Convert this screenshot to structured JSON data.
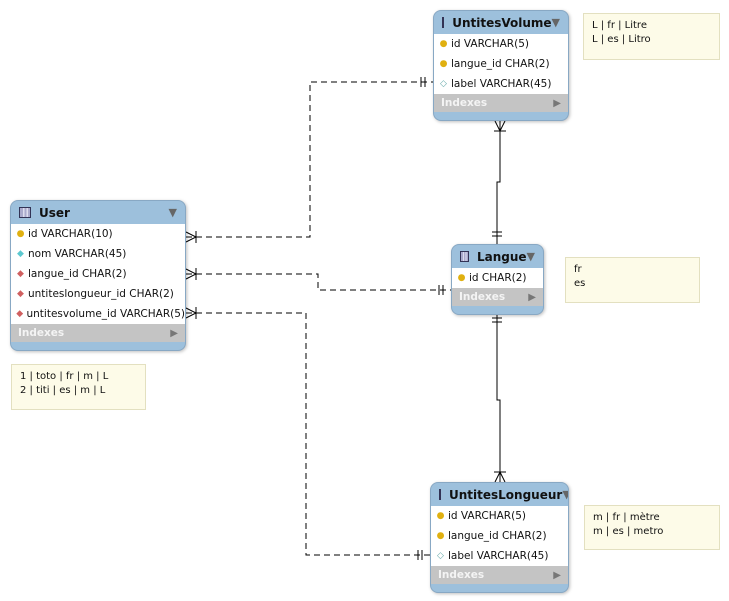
{
  "tables": {
    "volume": {
      "name": "UntitesVolume",
      "columns": [
        {
          "icon": "key",
          "text": "id VARCHAR(5)"
        },
        {
          "icon": "key",
          "text": "langue_id CHAR(2)"
        },
        {
          "icon": "empty-diamond",
          "text": "label VARCHAR(45)"
        }
      ],
      "indexes": "Indexes"
    },
    "user": {
      "name": "User",
      "columns": [
        {
          "icon": "key",
          "text": "id VARCHAR(10)"
        },
        {
          "icon": "diamond",
          "text": "nom VARCHAR(45)"
        },
        {
          "icon": "fk-diamond",
          "text": "langue_id CHAR(2)"
        },
        {
          "icon": "fk-diamond",
          "text": "untiteslongueur_id CHAR(2)"
        },
        {
          "icon": "fk-diamond",
          "text": "untitesvolume_id VARCHAR(5)"
        }
      ],
      "indexes": "Indexes"
    },
    "langue": {
      "name": "Langue",
      "columns": [
        {
          "icon": "key",
          "text": "id CHAR(2)"
        }
      ],
      "indexes": "Indexes"
    },
    "longueur": {
      "name": "UntitesLongueur",
      "columns": [
        {
          "icon": "key",
          "text": "id VARCHAR(5)"
        },
        {
          "icon": "key",
          "text": "langue_id CHAR(2)"
        },
        {
          "icon": "empty-diamond",
          "text": "label VARCHAR(45)"
        }
      ],
      "indexes": "Indexes"
    }
  },
  "notes": {
    "volume": [
      "L | fr | Litre",
      "L | es | Litro"
    ],
    "langue": [
      "fr",
      "es"
    ],
    "user": [
      "1 | toto | fr | m | L",
      "2 | titi | es | m | L"
    ],
    "longueur": [
      "m | fr | mètre",
      "m | es | metro"
    ]
  }
}
